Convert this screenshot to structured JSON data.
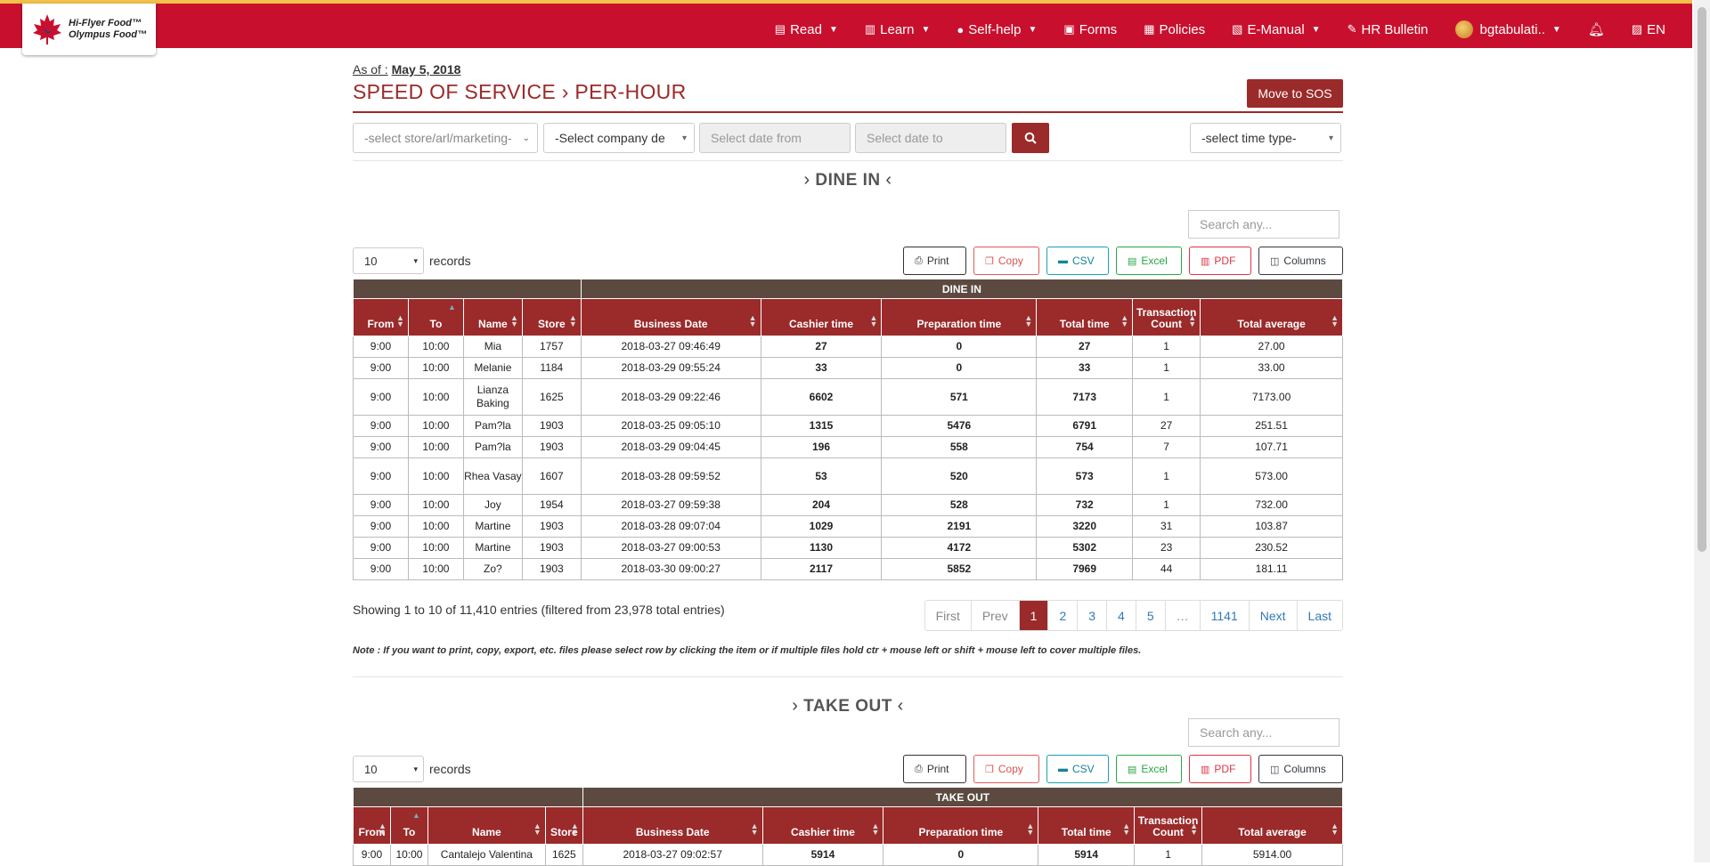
{
  "nav": {
    "logo_line1": "Hi-Flyer Food™",
    "logo_line2": "Olympus Food™",
    "items": [
      {
        "label": "Read",
        "icon": "newspaper-icon",
        "caret": true
      },
      {
        "label": "Learn",
        "icon": "book-icon",
        "caret": true
      },
      {
        "label": "Self-help",
        "icon": "help-circle-icon",
        "caret": true
      },
      {
        "label": "Forms",
        "icon": "form-icon",
        "caret": false
      },
      {
        "label": "Policies",
        "icon": "policy-icon",
        "caret": false
      },
      {
        "label": "E-Manual",
        "icon": "manual-icon",
        "caret": true
      },
      {
        "label": "HR Bulletin",
        "icon": "pin-icon",
        "caret": false
      }
    ],
    "user": "bgtabulati..",
    "lang": "EN"
  },
  "page": {
    "asof_label": "As of :",
    "asof_date": "May 5, 2018",
    "title": "SPEED OF SERVICE",
    "subtitle": "PER-HOUR",
    "move_button": "Move to SOS"
  },
  "filters": {
    "store": "-select store/arl/marketing-",
    "company": "-Select company de",
    "date_from": "Select date from",
    "date_to": "Select date to",
    "time_type": "-select time type-"
  },
  "common": {
    "search_placeholder": "Search any...",
    "records_value": "10",
    "records_label": "records",
    "tools": {
      "print": "Print",
      "copy": "Copy",
      "csv": "CSV",
      "excel": "Excel",
      "pdf": "PDF",
      "columns": "Columns"
    },
    "columns": [
      "From",
      "To",
      "Name",
      "Store",
      "Business Date",
      "Cashier time",
      "Preparation time",
      "Total time",
      "Transaction Count",
      "Total average"
    ]
  },
  "dine_in": {
    "heading": "DINE IN",
    "group_label": "DINE IN",
    "rows": [
      [
        "9:00",
        "10:00",
        "Mia",
        "1757",
        "2018-03-27 09:46:49",
        "27",
        "0",
        "27",
        "1",
        "27.00"
      ],
      [
        "9:00",
        "10:00",
        "Melanie",
        "1184",
        "2018-03-29 09:55:24",
        "33",
        "0",
        "33",
        "1",
        "33.00"
      ],
      [
        "9:00",
        "10:00",
        "Lianza Baking",
        "1625",
        "2018-03-29 09:22:46",
        "6602",
        "571",
        "7173",
        "1",
        "7173.00"
      ],
      [
        "9:00",
        "10:00",
        "Pam?la",
        "1903",
        "2018-03-25 09:05:10",
        "1315",
        "5476",
        "6791",
        "27",
        "251.51"
      ],
      [
        "9:00",
        "10:00",
        "Pam?la",
        "1903",
        "2018-03-29 09:04:45",
        "196",
        "558",
        "754",
        "7",
        "107.71"
      ],
      [
        "9:00",
        "10:00",
        "Rhea Vasay",
        "1607",
        "2018-03-28 09:59:52",
        "53",
        "520",
        "573",
        "1",
        "573.00"
      ],
      [
        "9:00",
        "10:00",
        "Joy",
        "1954",
        "2018-03-27 09:59:38",
        "204",
        "528",
        "732",
        "1",
        "732.00"
      ],
      [
        "9:00",
        "10:00",
        "Martine",
        "1903",
        "2018-03-28 09:07:04",
        "1029",
        "2191",
        "3220",
        "31",
        "103.87"
      ],
      [
        "9:00",
        "10:00",
        "Martine",
        "1903",
        "2018-03-27 09:00:53",
        "1130",
        "4172",
        "5302",
        "23",
        "230.52"
      ],
      [
        "9:00",
        "10:00",
        "Zo?",
        "1903",
        "2018-03-30 09:00:27",
        "2117",
        "5852",
        "7969",
        "44",
        "181.11"
      ]
    ],
    "showing": "Showing 1 to 10 of 11,410 entries (filtered from 23,978 total entries)",
    "pager": [
      "First",
      "Prev",
      "1",
      "2",
      "3",
      "4",
      "5",
      "…",
      "1141",
      "Next",
      "Last"
    ],
    "note": "Note : If you want to print, copy, export, etc. files please select row by clicking the item or if multiple files hold ctr + mouse left or shift + mouse left to cover multiple files."
  },
  "take_out": {
    "heading": "TAKE OUT",
    "group_label": "TAKE OUT",
    "rows": [
      [
        "9:00",
        "10:00",
        "Cantalejo Valentina",
        "1625",
        "2018-03-27 09:02:57",
        "5914",
        "0",
        "5914",
        "1",
        "5914.00"
      ]
    ]
  }
}
